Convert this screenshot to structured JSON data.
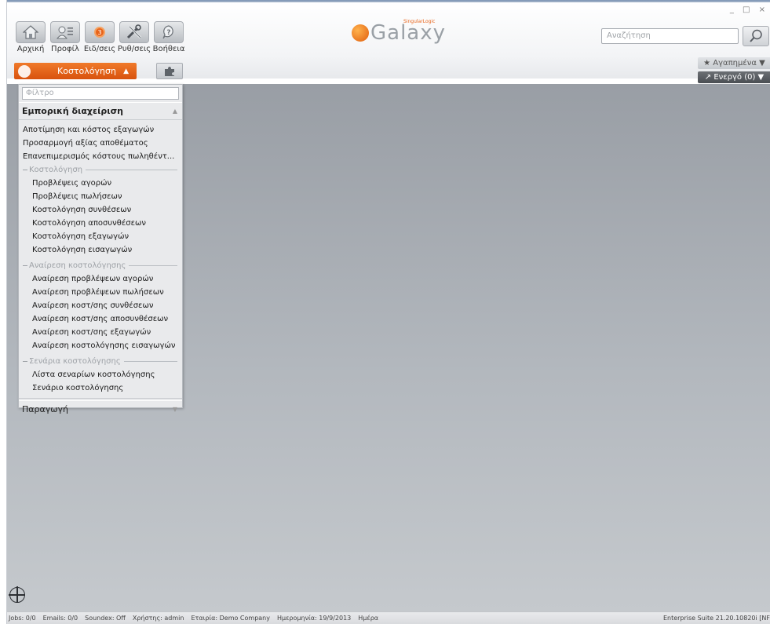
{
  "window": {
    "controls": "_ □ ×"
  },
  "toolbar": {
    "buttons": [
      {
        "label": "Αρχική",
        "icon": "home-icon"
      },
      {
        "label": "Προφίλ",
        "icon": "profile-icon"
      },
      {
        "label": "Ειδ/σεις",
        "icon": "notifications-icon",
        "badge": "3"
      },
      {
        "label": "Ρυθ/σεις",
        "icon": "settings-icon"
      },
      {
        "label": "Βοήθεια",
        "icon": "help-icon"
      }
    ]
  },
  "logo": {
    "text": "Galaxy",
    "sub": "SingularLogic"
  },
  "search": {
    "placeholder": "Αναζήτηση"
  },
  "module": {
    "label": "Κοστολόγηση",
    "arrow": "▲"
  },
  "favorites": {
    "label": "★ Αγαπημένα ▼"
  },
  "active": {
    "label": "↗ Ενεργό (0) ▼"
  },
  "panel": {
    "filter_placeholder": "Φίλτρο",
    "section1": {
      "title": "Εμπορική διαχείριση",
      "top_items": [
        "Αποτίμηση και κόστος εξαγωγών",
        "Προσαρμογή αξίας αποθέματος",
        "Επανεπιμερισμός κόστους πωληθέντ..."
      ],
      "groups": [
        {
          "title": "Κοστολόγηση",
          "items": [
            "Προβλέψεις αγορών",
            "Προβλέψεις πωλήσεων",
            "Κοστολόγηση συνθέσεων",
            "Κοστολόγηση αποσυνθέσεων",
            "Κοστολόγηση εξαγωγών",
            "Κοστολόγηση εισαγωγών"
          ]
        },
        {
          "title": "Αναίρεση κοστολόγησης",
          "items": [
            "Αναίρεση προβλέψεων αγορών",
            "Αναίρεση προβλέψεων πωλήσεων",
            "Αναίρεση κοστ/σης συνθέσεων",
            "Αναίρεση κοστ/σης αποσυνθέσεων",
            "Αναίρεση κοστ/σης εξαγωγών",
            "Αναίρεση κοστολόγησης εισαγωγών"
          ]
        },
        {
          "title": "Σενάρια κοστολόγησης",
          "items": [
            "Λίστα σεναρίων κοστολόγησης",
            "Σενάριο κοστολόγησης"
          ]
        }
      ]
    },
    "section2": {
      "title": "Παραγωγή"
    }
  },
  "status": {
    "jobs": "Jobs: 0/0",
    "emails": "Emails: 0/0",
    "soundex": "Soundex: Off",
    "user": "Χρήστης: admin",
    "company": "Εταιρία: Demo Company",
    "date": "Ημερομηνία: 19/9/2013",
    "day": "Ημέρα",
    "version": "Enterprise Suite  21.20.10820i [NF"
  }
}
